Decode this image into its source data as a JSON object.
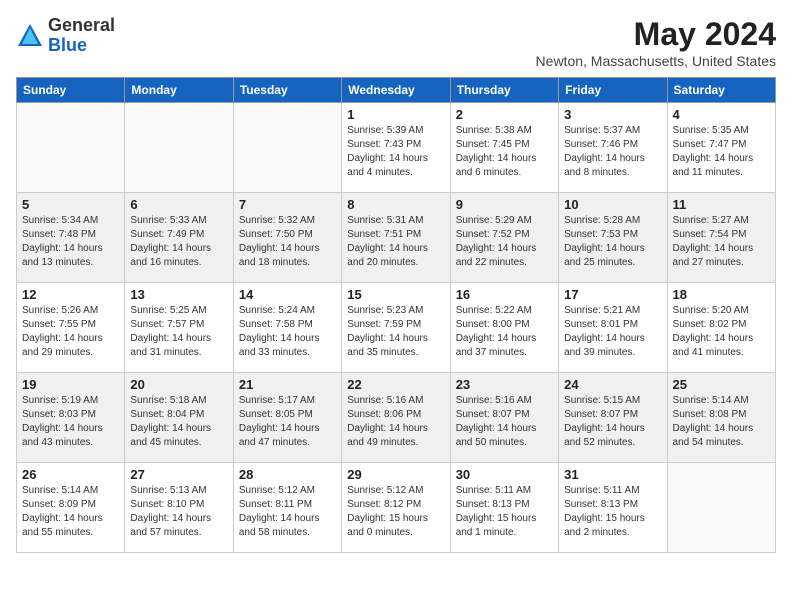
{
  "header": {
    "logo_general": "General",
    "logo_blue": "Blue",
    "month_year": "May 2024",
    "location": "Newton, Massachusetts, United States"
  },
  "weekdays": [
    "Sunday",
    "Monday",
    "Tuesday",
    "Wednesday",
    "Thursday",
    "Friday",
    "Saturday"
  ],
  "weeks": [
    [
      {
        "day": "",
        "info": ""
      },
      {
        "day": "",
        "info": ""
      },
      {
        "day": "",
        "info": ""
      },
      {
        "day": "1",
        "info": "Sunrise: 5:39 AM\nSunset: 7:43 PM\nDaylight: 14 hours\nand 4 minutes."
      },
      {
        "day": "2",
        "info": "Sunrise: 5:38 AM\nSunset: 7:45 PM\nDaylight: 14 hours\nand 6 minutes."
      },
      {
        "day": "3",
        "info": "Sunrise: 5:37 AM\nSunset: 7:46 PM\nDaylight: 14 hours\nand 8 minutes."
      },
      {
        "day": "4",
        "info": "Sunrise: 5:35 AM\nSunset: 7:47 PM\nDaylight: 14 hours\nand 11 minutes."
      }
    ],
    [
      {
        "day": "5",
        "info": "Sunrise: 5:34 AM\nSunset: 7:48 PM\nDaylight: 14 hours\nand 13 minutes."
      },
      {
        "day": "6",
        "info": "Sunrise: 5:33 AM\nSunset: 7:49 PM\nDaylight: 14 hours\nand 16 minutes."
      },
      {
        "day": "7",
        "info": "Sunrise: 5:32 AM\nSunset: 7:50 PM\nDaylight: 14 hours\nand 18 minutes."
      },
      {
        "day": "8",
        "info": "Sunrise: 5:31 AM\nSunset: 7:51 PM\nDaylight: 14 hours\nand 20 minutes."
      },
      {
        "day": "9",
        "info": "Sunrise: 5:29 AM\nSunset: 7:52 PM\nDaylight: 14 hours\nand 22 minutes."
      },
      {
        "day": "10",
        "info": "Sunrise: 5:28 AM\nSunset: 7:53 PM\nDaylight: 14 hours\nand 25 minutes."
      },
      {
        "day": "11",
        "info": "Sunrise: 5:27 AM\nSunset: 7:54 PM\nDaylight: 14 hours\nand 27 minutes."
      }
    ],
    [
      {
        "day": "12",
        "info": "Sunrise: 5:26 AM\nSunset: 7:55 PM\nDaylight: 14 hours\nand 29 minutes."
      },
      {
        "day": "13",
        "info": "Sunrise: 5:25 AM\nSunset: 7:57 PM\nDaylight: 14 hours\nand 31 minutes."
      },
      {
        "day": "14",
        "info": "Sunrise: 5:24 AM\nSunset: 7:58 PM\nDaylight: 14 hours\nand 33 minutes."
      },
      {
        "day": "15",
        "info": "Sunrise: 5:23 AM\nSunset: 7:59 PM\nDaylight: 14 hours\nand 35 minutes."
      },
      {
        "day": "16",
        "info": "Sunrise: 5:22 AM\nSunset: 8:00 PM\nDaylight: 14 hours\nand 37 minutes."
      },
      {
        "day": "17",
        "info": "Sunrise: 5:21 AM\nSunset: 8:01 PM\nDaylight: 14 hours\nand 39 minutes."
      },
      {
        "day": "18",
        "info": "Sunrise: 5:20 AM\nSunset: 8:02 PM\nDaylight: 14 hours\nand 41 minutes."
      }
    ],
    [
      {
        "day": "19",
        "info": "Sunrise: 5:19 AM\nSunset: 8:03 PM\nDaylight: 14 hours\nand 43 minutes."
      },
      {
        "day": "20",
        "info": "Sunrise: 5:18 AM\nSunset: 8:04 PM\nDaylight: 14 hours\nand 45 minutes."
      },
      {
        "day": "21",
        "info": "Sunrise: 5:17 AM\nSunset: 8:05 PM\nDaylight: 14 hours\nand 47 minutes."
      },
      {
        "day": "22",
        "info": "Sunrise: 5:16 AM\nSunset: 8:06 PM\nDaylight: 14 hours\nand 49 minutes."
      },
      {
        "day": "23",
        "info": "Sunrise: 5:16 AM\nSunset: 8:07 PM\nDaylight: 14 hours\nand 50 minutes."
      },
      {
        "day": "24",
        "info": "Sunrise: 5:15 AM\nSunset: 8:07 PM\nDaylight: 14 hours\nand 52 minutes."
      },
      {
        "day": "25",
        "info": "Sunrise: 5:14 AM\nSunset: 8:08 PM\nDaylight: 14 hours\nand 54 minutes."
      }
    ],
    [
      {
        "day": "26",
        "info": "Sunrise: 5:14 AM\nSunset: 8:09 PM\nDaylight: 14 hours\nand 55 minutes."
      },
      {
        "day": "27",
        "info": "Sunrise: 5:13 AM\nSunset: 8:10 PM\nDaylight: 14 hours\nand 57 minutes."
      },
      {
        "day": "28",
        "info": "Sunrise: 5:12 AM\nSunset: 8:11 PM\nDaylight: 14 hours\nand 58 minutes."
      },
      {
        "day": "29",
        "info": "Sunrise: 5:12 AM\nSunset: 8:12 PM\nDaylight: 15 hours\nand 0 minutes."
      },
      {
        "day": "30",
        "info": "Sunrise: 5:11 AM\nSunset: 8:13 PM\nDaylight: 15 hours\nand 1 minute."
      },
      {
        "day": "31",
        "info": "Sunrise: 5:11 AM\nSunset: 8:13 PM\nDaylight: 15 hours\nand 2 minutes."
      },
      {
        "day": "",
        "info": ""
      }
    ]
  ]
}
